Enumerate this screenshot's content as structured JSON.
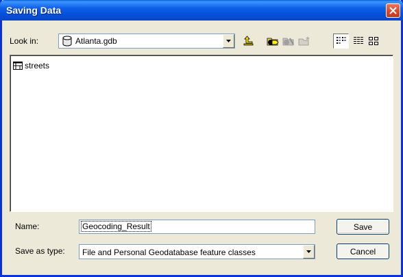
{
  "window": {
    "title": "Saving Data"
  },
  "toolbar": {
    "look_in_label": "Look in:",
    "look_in_value": "Atlanta.gdb",
    "buttons": [
      {
        "name": "up-one-level-icon"
      },
      {
        "name": "connect-to-folder-icon"
      },
      {
        "name": "disconnect-folder-icon"
      },
      {
        "name": "new-folder-icon"
      },
      {
        "name": "list-view-icon"
      },
      {
        "name": "details-view-icon"
      },
      {
        "name": "thumbnails-view-icon"
      }
    ]
  },
  "file_list": {
    "items": [
      {
        "label": "streets",
        "icon": "feature-class-icon"
      }
    ]
  },
  "form": {
    "name_label": "Name:",
    "name_value": "Geocoding_Result",
    "type_label": "Save as type:",
    "type_value": "File and Personal Geodatabase feature classes"
  },
  "actions": {
    "save_label": "Save",
    "cancel_label": "Cancel"
  },
  "colors": {
    "titlebar": "#0550dc",
    "face": "#ece9d8",
    "close": "#d9442a"
  }
}
